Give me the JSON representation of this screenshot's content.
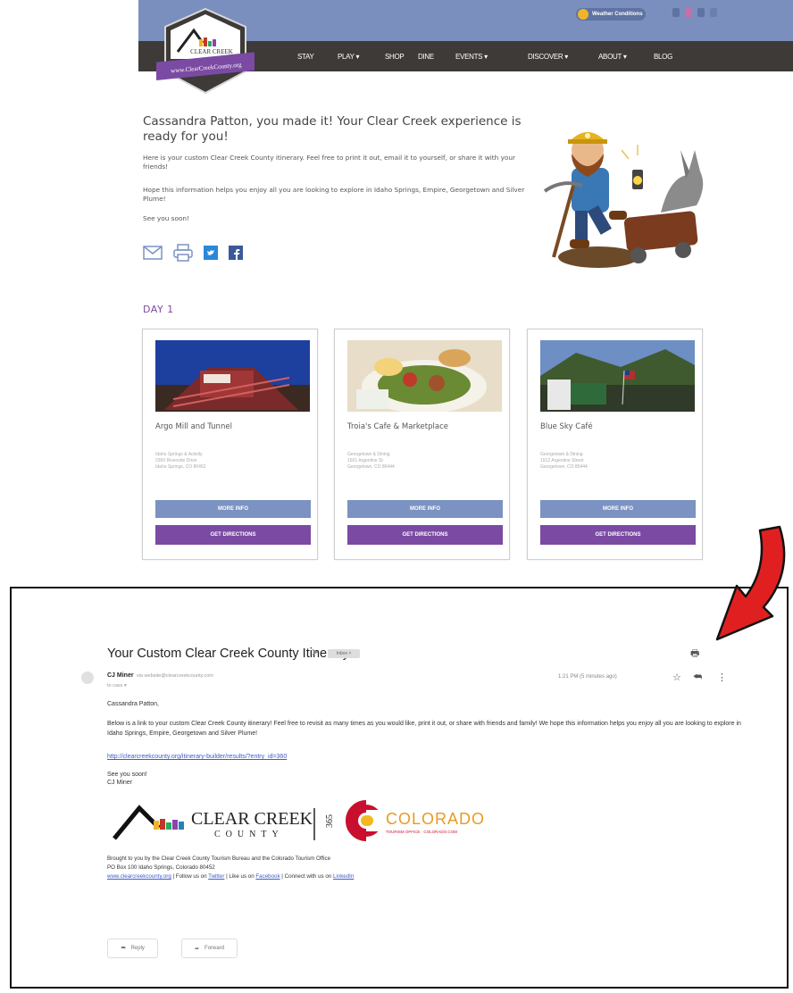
{
  "site": {
    "top_pill": "Weather Conditions",
    "logo_text": "CLEAR CREEK",
    "logo_sub": "COUNTY",
    "logo_banner": "www.ClearCreekCounty.org",
    "nav": [
      "STAY",
      "PLAY ▾",
      "SHOP",
      "DINE",
      "EVENTS ▾",
      "DISCOVER ▾",
      "ABOUT ▾",
      "BLOG"
    ],
    "colors": {
      "topbar": "#7a8fbd",
      "navbar": "#3d3a38",
      "purple": "#7b4aa3",
      "blue_btn": "#7b92c2"
    }
  },
  "hero": {
    "title": "Cassandra Patton, you made it! Your Clear Creek experience is ready for you!",
    "p1": "Here is your custom Clear Creek County itinerary. Feel free to print it out, email it to yourself, or share it with your friends!",
    "p2": "Hope this information helps you enjoy all you are looking to explore in Idaho Springs, Empire, Georgetown and Silver Plume!",
    "p3": "See you soon!",
    "share_icons": [
      "email-icon",
      "print-icon",
      "twitter-icon",
      "facebook-icon"
    ]
  },
  "day": {
    "label": "DAY 1"
  },
  "cards": [
    {
      "name": "Argo Mill and Tunnel",
      "addr1": "Idaho Springs & Activity",
      "addr2": "2350 Riverside Drive",
      "addr3": "Idaho Springs, CO 80452",
      "more": "MORE INFO",
      "dir": "GET DIRECTIONS"
    },
    {
      "name": "Troia's Cafe & Marketplace",
      "addr1": "Georgetown & Dining",
      "addr2": "1501 Argentine St",
      "addr3": "Georgetown, CO 80444",
      "more": "MORE INFO",
      "dir": "GET DIRECTIONS"
    },
    {
      "name": "Blue Sky Café",
      "addr1": "Georgetown & Dining",
      "addr2": "1512 Argentine Street",
      "addr3": "Georgetown, CO 80444",
      "more": "MORE INFO",
      "dir": "GET DIRECTIONS"
    }
  ],
  "email": {
    "subject": "Your Custom Clear Creek County Itinerary",
    "inbox_tag": "Inbox ×",
    "sender": "CJ Miner",
    "sender_addr": "via website@clearcreekcounty.com",
    "to": "to cass ▾",
    "time": "1:21 PM (5 minutes ago)",
    "greeting": "Cassandra Patton,",
    "body1": "Below is a link to your custom Clear Creek County itinerary! Feel free to revisit as many times as you would like, print it out, or share with friends and family! We hope this information helps you enjoy all you are looking to explore in Idaho Springs, Empire, Georgetown and Silver Plume!",
    "link": "http://clearcreekcounty.org/itinerary-builder/results/?entry_id=360",
    "signoff1": "See you soon!",
    "signoff2": "CJ Miner",
    "logo1": "CLEAR CREEK",
    "logo1_sub": "COUNTY",
    "logo1_side": "365",
    "logo2": "COLORADO",
    "logo2_sub": "TOURISM OFFICE · COLORADO.COM",
    "footer1": "Brought to you by the Clear Creek County Tourism Bureau and the Colorado Tourism Office",
    "footer2": "PO Box 100 Idaho Springs, Colorado 80452",
    "footer3_link": "www.clearcreekcounty.org",
    "footer3_a": " | Follow us on ",
    "footer3_twitter": "Twitter",
    "footer3_b": " | Like us on ",
    "footer3_facebook": "Facebook",
    "footer3_c": " | Connect with us on ",
    "footer3_linkedin": "LinkedIn",
    "reply": "Reply",
    "forward": "Forward"
  }
}
